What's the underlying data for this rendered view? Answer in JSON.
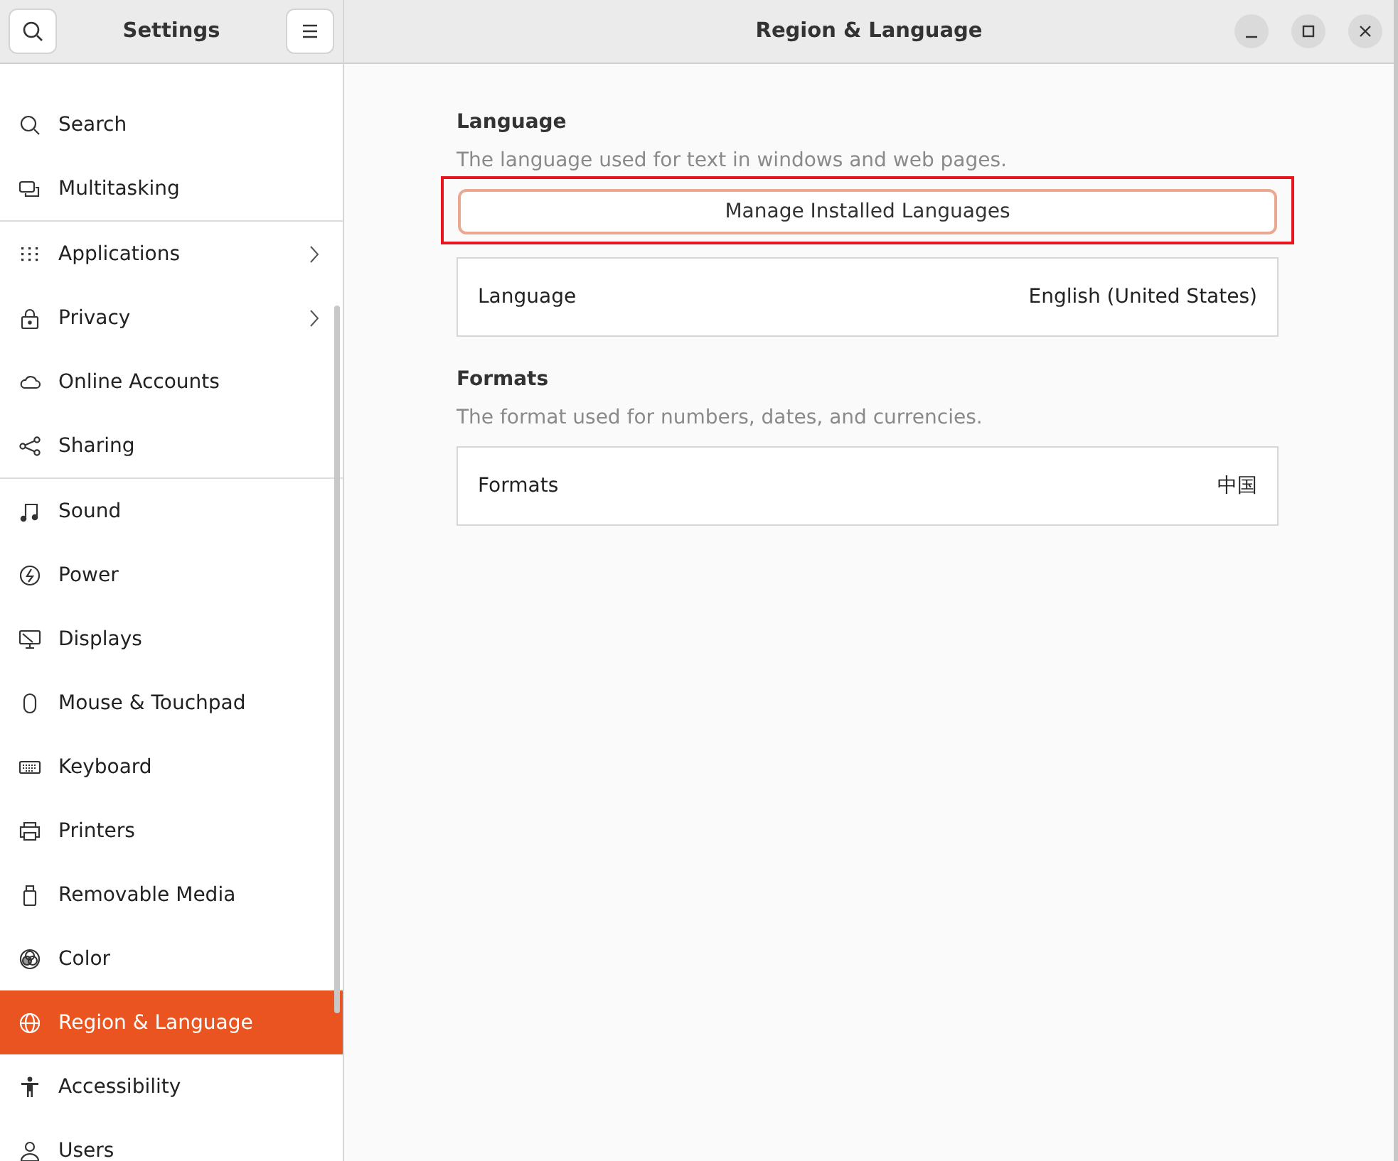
{
  "sidebar": {
    "title": "Settings",
    "items": [
      {
        "label": "Search",
        "selected": false,
        "chevron": false,
        "divider_after": false
      },
      {
        "label": "Multitasking",
        "selected": false,
        "chevron": false,
        "divider_after": true
      },
      {
        "label": "Applications",
        "selected": false,
        "chevron": true,
        "divider_after": false
      },
      {
        "label": "Privacy",
        "selected": false,
        "chevron": true,
        "divider_after": false
      },
      {
        "label": "Online Accounts",
        "selected": false,
        "chevron": false,
        "divider_after": false
      },
      {
        "label": "Sharing",
        "selected": false,
        "chevron": false,
        "divider_after": true
      },
      {
        "label": "Sound",
        "selected": false,
        "chevron": false,
        "divider_after": false
      },
      {
        "label": "Power",
        "selected": false,
        "chevron": false,
        "divider_after": false
      },
      {
        "label": "Displays",
        "selected": false,
        "chevron": false,
        "divider_after": false
      },
      {
        "label": "Mouse & Touchpad",
        "selected": false,
        "chevron": false,
        "divider_after": false
      },
      {
        "label": "Keyboard",
        "selected": false,
        "chevron": false,
        "divider_after": false
      },
      {
        "label": "Printers",
        "selected": false,
        "chevron": false,
        "divider_after": false
      },
      {
        "label": "Removable Media",
        "selected": false,
        "chevron": false,
        "divider_after": false
      },
      {
        "label": "Color",
        "selected": false,
        "chevron": false,
        "divider_after": false
      },
      {
        "label": "Region & Language",
        "selected": true,
        "chevron": false,
        "divider_after": false
      },
      {
        "label": "Accessibility",
        "selected": false,
        "chevron": false,
        "divider_after": false
      },
      {
        "label": "Users",
        "selected": false,
        "chevron": false,
        "divider_after": false
      }
    ]
  },
  "window": {
    "title": "Region & Language"
  },
  "sections": [
    {
      "heading": "Language",
      "description": "The language used for text in windows and web pages.",
      "button": {
        "label": "Manage Installed Languages",
        "highlighted": true
      },
      "row": {
        "label": "Language",
        "value": "English (United States)"
      }
    },
    {
      "heading": "Formats",
      "description": "The format used for numbers, dates, and currencies.",
      "row": {
        "label": "Formats",
        "value": "中国"
      }
    }
  ]
}
